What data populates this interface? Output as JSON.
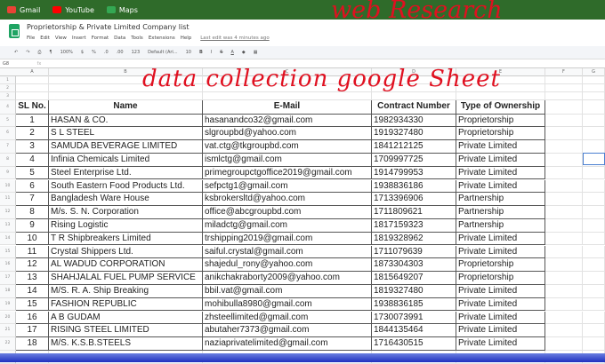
{
  "bookmarks": [
    {
      "label": "Gmail",
      "color": "#ea4335"
    },
    {
      "label": "YouTube",
      "color": "#ff0000"
    },
    {
      "label": "Maps",
      "color": "#34a853"
    }
  ],
  "doc": {
    "title": "Proprietorship & Private Limited Company list",
    "menu": [
      "File",
      "Edit",
      "View",
      "Insert",
      "Format",
      "Data",
      "Tools",
      "Extensions",
      "Help"
    ],
    "last_edit": "Last edit was 4 minutes ago"
  },
  "toolbar": {
    "zoom": "100%",
    "currency": "$",
    "percent": "%",
    "dec1": ".0",
    "dec2": ".00",
    "format": "123",
    "font": "Default (Ari...",
    "size": "10",
    "bold": "B",
    "italic": "I",
    "strike": "S",
    "color": "A"
  },
  "formula": {
    "cell_ref": "G8",
    "fx": "fx"
  },
  "annotations": {
    "top": "web Research",
    "middle": "data collection google Sheet"
  },
  "columns": [
    "A",
    "B",
    "C",
    "D",
    "E",
    "F",
    "G"
  ],
  "headers": [
    "SL No.",
    "Name",
    "E-Mail",
    "Contract Number",
    "Type of Ownership"
  ],
  "rows": [
    [
      "1",
      "HASAN & CO.",
      "hasanandco32@gmail.com",
      "1982934330",
      "Proprietorship"
    ],
    [
      "2",
      "S L STEEL",
      "slgroupbd@yahoo.com",
      "1919327480",
      "Proprietorship"
    ],
    [
      "3",
      "SAMUDA BEVERAGE LIMITED",
      "vat.ctg@tkgroupbd.com",
      "1841212125",
      "Private Limited"
    ],
    [
      "4",
      "Infinia Chemicals Limited",
      "ismlctg@gmail.com",
      "1709997725",
      "Private Limited"
    ],
    [
      "5",
      "Steel Enterprise Ltd.",
      "primegroupctgoffice2019@gmail.com",
      "1914799953",
      "Private Limited"
    ],
    [
      "6",
      "South Eastern Food Products Ltd.",
      "sefpctg1@gmail.com",
      "1938836186",
      "Private Limited"
    ],
    [
      "7",
      "Bangladesh Ware House",
      "ksbrokersltd@yahoo.com",
      "1713396906",
      "Partnership"
    ],
    [
      "8",
      "M/s. S. N. Corporation",
      "office@abcgroupbd.com",
      "1711809621",
      "Partnership"
    ],
    [
      "9",
      "Rising Logistic",
      "miladctg@gmail.com",
      "1817159323",
      "Partnership"
    ],
    [
      "10",
      "T R Shipbreakers Limited",
      "trshipping2019@gmail.com",
      "1819328962",
      "Private Limited"
    ],
    [
      "11",
      "Crystal Shippers Ltd.",
      "saiful.crystal@gmail.com",
      "1711079639",
      "Private Limited"
    ],
    [
      "12",
      "AL WADUD CORPORATION",
      "shajedul_rony@yahoo.com",
      "1873304303",
      "Proprietorship"
    ],
    [
      "13",
      "SHAHJALAL FUEL PUMP SERVICE",
      "anikchakraborty2009@yahoo.com",
      "1815649207",
      "Proprietorship"
    ],
    [
      "14",
      "M/S. R. A. Ship Breaking",
      "bbil.vat@gmail.com",
      "1819327480",
      "Private Limited"
    ],
    [
      "15",
      "FASHION REPUBLIC",
      "mohibulla8980@gmail.com",
      "1938836185",
      "Private Limited"
    ],
    [
      "16",
      "A B GUDAM",
      "zhsteellimited@gmail.com",
      "1730073991",
      "Private Limited"
    ],
    [
      "17",
      "RISING STEEL LIMITED",
      "abutaher7373@gmail.com",
      "1844135464",
      "Private Limited"
    ],
    [
      "18",
      "M/S. K.S.B.STEELS",
      "naziaprivatelimited@gmail.com",
      "1716430515",
      "Private Limited"
    ]
  ]
}
